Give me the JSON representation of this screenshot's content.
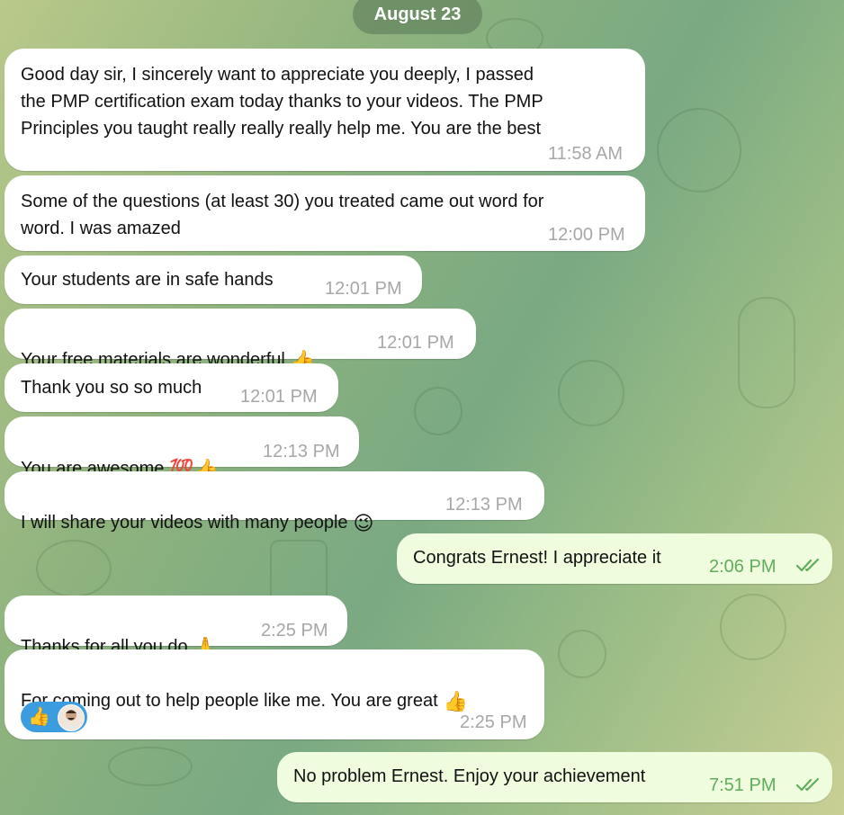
{
  "date_label": "August 23",
  "messages": [
    {
      "text": "Good day sir, I sincerely want to appreciate you deeply, I passed\nthe PMP certification exam today thanks to your videos. The PMP\nPrinciples you taught really really really help me. You are the best",
      "time": "11:58 AM"
    },
    {
      "text": "Some of the questions (at least 30) you treated came out word for\nword. I was amazed",
      "time": "12:00 PM"
    },
    {
      "text": "Your students are in safe hands",
      "time": "12:01 PM"
    },
    {
      "text": "Your free materials are wonderful",
      "emoji": "👍",
      "time": "12:01 PM"
    },
    {
      "text": "Thank you so so much",
      "time": "12:01 PM"
    },
    {
      "text": "You are awesome",
      "emoji": "💯👍",
      "time": "12:13 PM"
    },
    {
      "text": "I will share your videos with many people",
      "emoji": "😉",
      "time": "12:13 PM"
    },
    {
      "text": "Congrats Ernest! I appreciate it",
      "time": "2:06 PM",
      "outgoing": true
    },
    {
      "text": "Thanks for all you do",
      "emoji": "🙏",
      "time": "2:25 PM"
    },
    {
      "text": "For coming out to help people like me. You are great",
      "emoji": "👍",
      "time": "2:25 PM",
      "reaction": "👍"
    },
    {
      "text": "No problem Ernest. Enjoy your achievement",
      "time": "7:51 PM",
      "outgoing": true
    }
  ],
  "colors": {
    "incoming_bubble": "#ffffff",
    "outgoing_bubble": "#effdde",
    "outgoing_time": "#5fae5a",
    "reaction_pill": "#3b9de0"
  },
  "icons": {
    "read_receipt": "double-check-icon",
    "reaction_avatar": "avatar"
  }
}
